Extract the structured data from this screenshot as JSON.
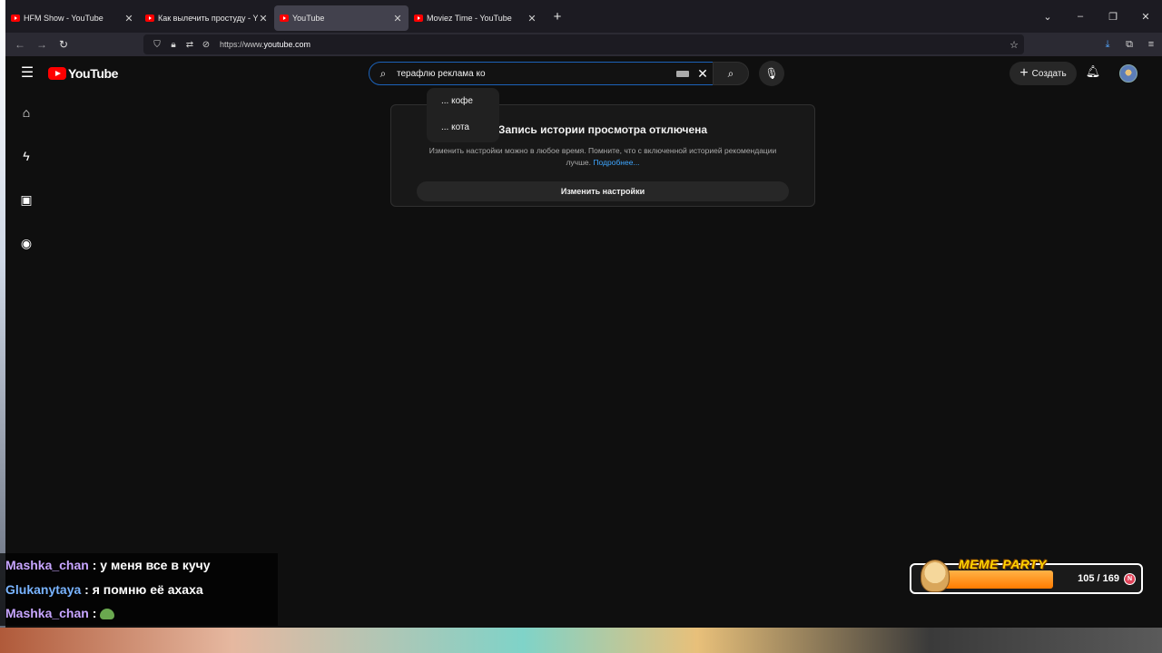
{
  "browser": {
    "tabs": [
      {
        "title": "HFM Show - YouTube",
        "active": false
      },
      {
        "title": "Как вылечить простуду - YouTube",
        "active": false
      },
      {
        "title": "YouTube",
        "active": true
      },
      {
        "title": "Moviez Time - YouTube",
        "active": false
      }
    ],
    "url_prefix": "https://www.",
    "url_domain": "youtube.com",
    "colors": {
      "accent": "#54a7ff",
      "tab_active": "#42414d"
    }
  },
  "youtube": {
    "logo_text": "YouTube",
    "search": {
      "query": "терафлю реклама ко",
      "suggestions": [
        "... кофе",
        "... кота"
      ]
    },
    "create_label": "Создать",
    "sidebar_icons": [
      "home-icon",
      "shorts-icon",
      "subscriptions-icon",
      "you-icon"
    ],
    "notice": {
      "heading": "Запись истории просмотра отключена",
      "body": "Изменить настройки можно в любое время. Помните, что с включенной историей рекомендации лучше.",
      "link": "Подробнее...",
      "button": "Изменить настройки"
    },
    "colors": {
      "brand": "#ff0000",
      "link": "#3ea6ff"
    }
  },
  "overlay": {
    "chat": [
      {
        "user": "Mashka_chan",
        "text": " : у меня все в кучу"
      },
      {
        "user": "Glukanytaya",
        "text": " : я помню её ахаха"
      },
      {
        "user": "Mashka_chan",
        "text": " : "
      }
    ],
    "meme_party": {
      "label": "MEME PARTY",
      "count": "105 / 169",
      "progress": 0.62
    }
  }
}
